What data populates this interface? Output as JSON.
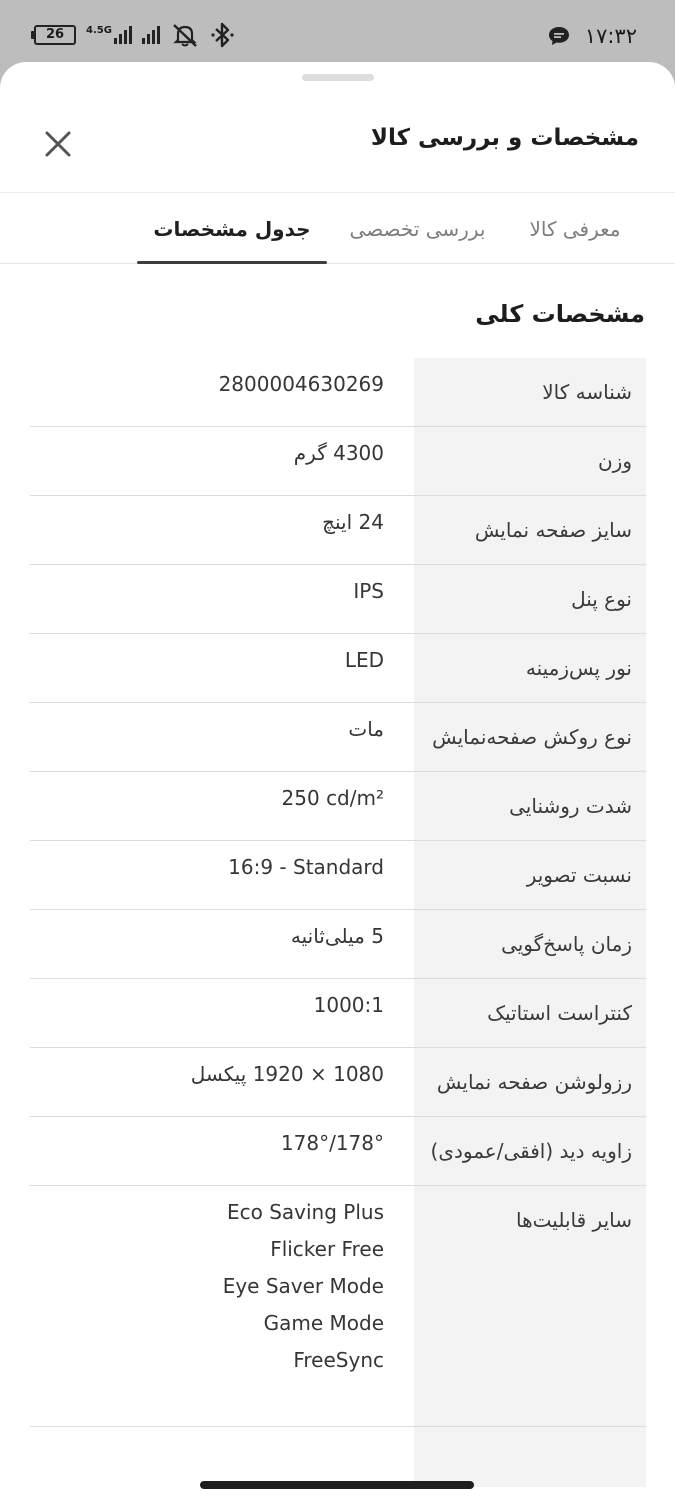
{
  "status_bar": {
    "battery": "26",
    "network": "4.5G",
    "time": "١٧:٣٢"
  },
  "header": {
    "title": "مشخصات و بررسی کالا"
  },
  "tabs": [
    {
      "label": "معرفی کالا",
      "active": false
    },
    {
      "label": "بررسی تخصصی",
      "active": false
    },
    {
      "label": "جدول مشخصات",
      "active": true
    }
  ],
  "section": {
    "title": "مشخصات کلی"
  },
  "specs": [
    {
      "key": "شناسه کالا",
      "value": "2800004630269"
    },
    {
      "key": "وزن",
      "value": "4300 گرم"
    },
    {
      "key": "سایز صفحه نمایش",
      "value": "24 اینچ"
    },
    {
      "key": "نوع پنل",
      "value": "IPS"
    },
    {
      "key": "نور پس‌زمینه",
      "value": "LED"
    },
    {
      "key": "نوع روکش صفحه‌نمایش",
      "value": "مات"
    },
    {
      "key": "شدت روشنایی",
      "value": "250 cd/m²"
    },
    {
      "key": "نسبت تصویر",
      "value": "16:9 - Standard"
    },
    {
      "key": "زمان پاسخ‌گویی",
      "value": "5 میلی‌ثانیه"
    },
    {
      "key": "کنتراست استاتیک",
      "value": "1000:1"
    },
    {
      "key": "رزولوشن صفحه نمایش",
      "value": "1080 × 1920 پیکسل"
    },
    {
      "key": "زاویه دید (افقی/عمودی)",
      "value": "178°/178°"
    },
    {
      "key": "سایر قابلیت‌ها",
      "values": [
        "Eco Saving Plus",
        "Flicker Free",
        "Eye Saver Mode",
        "Game Mode",
        "FreeSync"
      ]
    }
  ],
  "icons": {
    "close": "close-icon",
    "chat": "chat-bubble-icon",
    "mute": "mute-icon",
    "bluetooth": "bluetooth-icon"
  }
}
